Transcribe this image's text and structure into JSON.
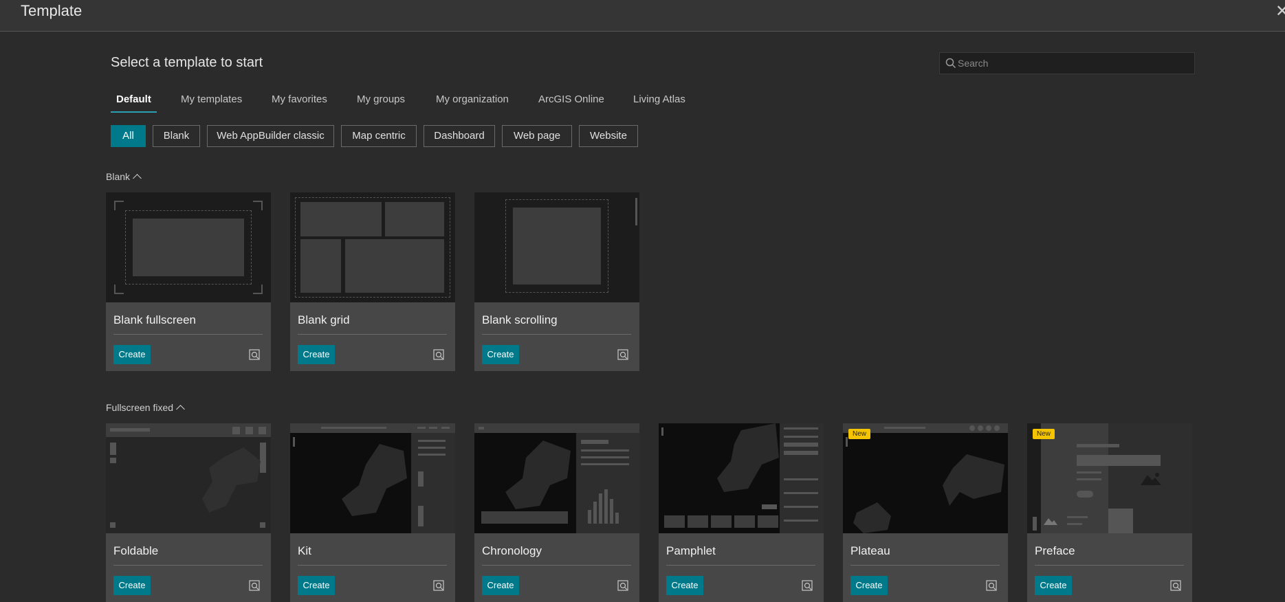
{
  "window": {
    "title": "Template",
    "close_icon": "close-icon"
  },
  "heading": "Select a template to start",
  "search": {
    "placeholder": "Search",
    "value": ""
  },
  "tabs": [
    "Default",
    "My templates",
    "My favorites",
    "My groups",
    "My organization",
    "ArcGIS Online",
    "Living Atlas"
  ],
  "active_tab": "Default",
  "filters": [
    "All",
    "Blank",
    "Web AppBuilder classic",
    "Map centric",
    "Dashboard",
    "Web page",
    "Website"
  ],
  "active_filter": "All",
  "sections": [
    {
      "title": "Blank",
      "cards": [
        {
          "name": "Blank fullscreen",
          "create_label": "Create"
        },
        {
          "name": "Blank grid",
          "create_label": "Create"
        },
        {
          "name": "Blank scrolling",
          "create_label": "Create"
        }
      ]
    },
    {
      "title": "Fullscreen fixed",
      "cards": [
        {
          "name": "Foldable",
          "create_label": "Create"
        },
        {
          "name": "Kit",
          "create_label": "Create"
        },
        {
          "name": "Chronology",
          "create_label": "Create"
        },
        {
          "name": "Pamphlet",
          "create_label": "Create"
        },
        {
          "name": "Plateau",
          "create_label": "Create",
          "badge": "New"
        },
        {
          "name": "Preface",
          "create_label": "Create",
          "badge": "New"
        }
      ]
    }
  ],
  "colors": {
    "accent": "#007a8a",
    "tab_underline": "#2aa1b5",
    "badge": "#f5c400",
    "background": "#2b2b2b"
  }
}
